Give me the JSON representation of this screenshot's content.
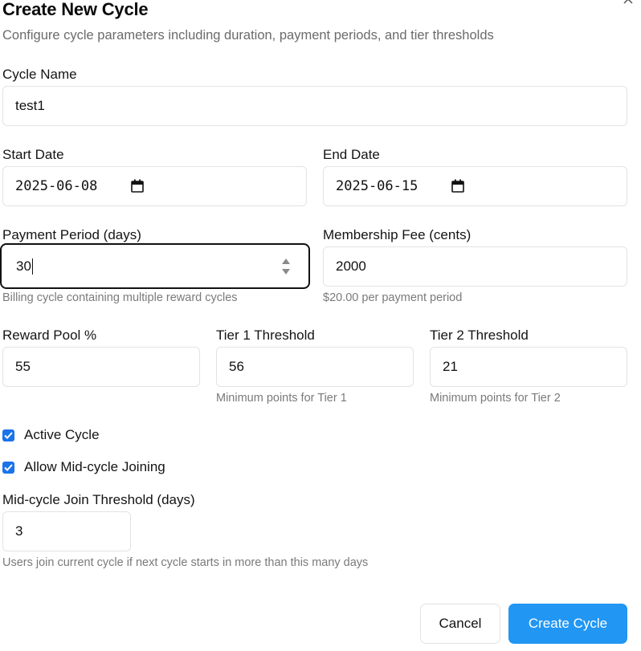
{
  "dialog": {
    "title": "Create New Cycle",
    "subtitle": "Configure cycle parameters including duration, payment periods, and tier thresholds"
  },
  "fields": {
    "cycle_name": {
      "label": "Cycle Name",
      "value": "test1"
    },
    "start_date": {
      "label": "Start Date",
      "value": "2025-06-08"
    },
    "end_date": {
      "label": "End Date",
      "value": "2025-06-15"
    },
    "payment_period": {
      "label": "Payment Period (days)",
      "value": "30",
      "help": "Billing cycle containing multiple reward cycles"
    },
    "membership_fee": {
      "label": "Membership Fee (cents)",
      "value": "2000",
      "help": "$20.00 per payment period"
    },
    "reward_pool": {
      "label": "Reward Pool %",
      "value": "55"
    },
    "tier1": {
      "label": "Tier 1 Threshold",
      "value": "56",
      "help": "Minimum points for Tier 1"
    },
    "tier2": {
      "label": "Tier 2 Threshold",
      "value": "21",
      "help": "Minimum points for Tier 2"
    },
    "mid_cycle_threshold": {
      "label": "Mid-cycle Join Threshold (days)",
      "value": "3",
      "help": "Users join current cycle if next cycle starts in more than this many days"
    }
  },
  "checkboxes": {
    "active": {
      "label": "Active Cycle",
      "checked": true
    },
    "allow_mid_cycle": {
      "label": "Allow Mid-cycle Joining",
      "checked": true
    }
  },
  "buttons": {
    "cancel": "Cancel",
    "create": "Create Cycle"
  },
  "colors": {
    "primary": "#2196f3",
    "checkbox": "#1a73e8",
    "border": "#e1e3e6",
    "help_text": "#7a7a7a"
  },
  "icons": [
    "close-icon",
    "calendar-icon",
    "spinner-arrows-icon",
    "checkmark-icon"
  ]
}
